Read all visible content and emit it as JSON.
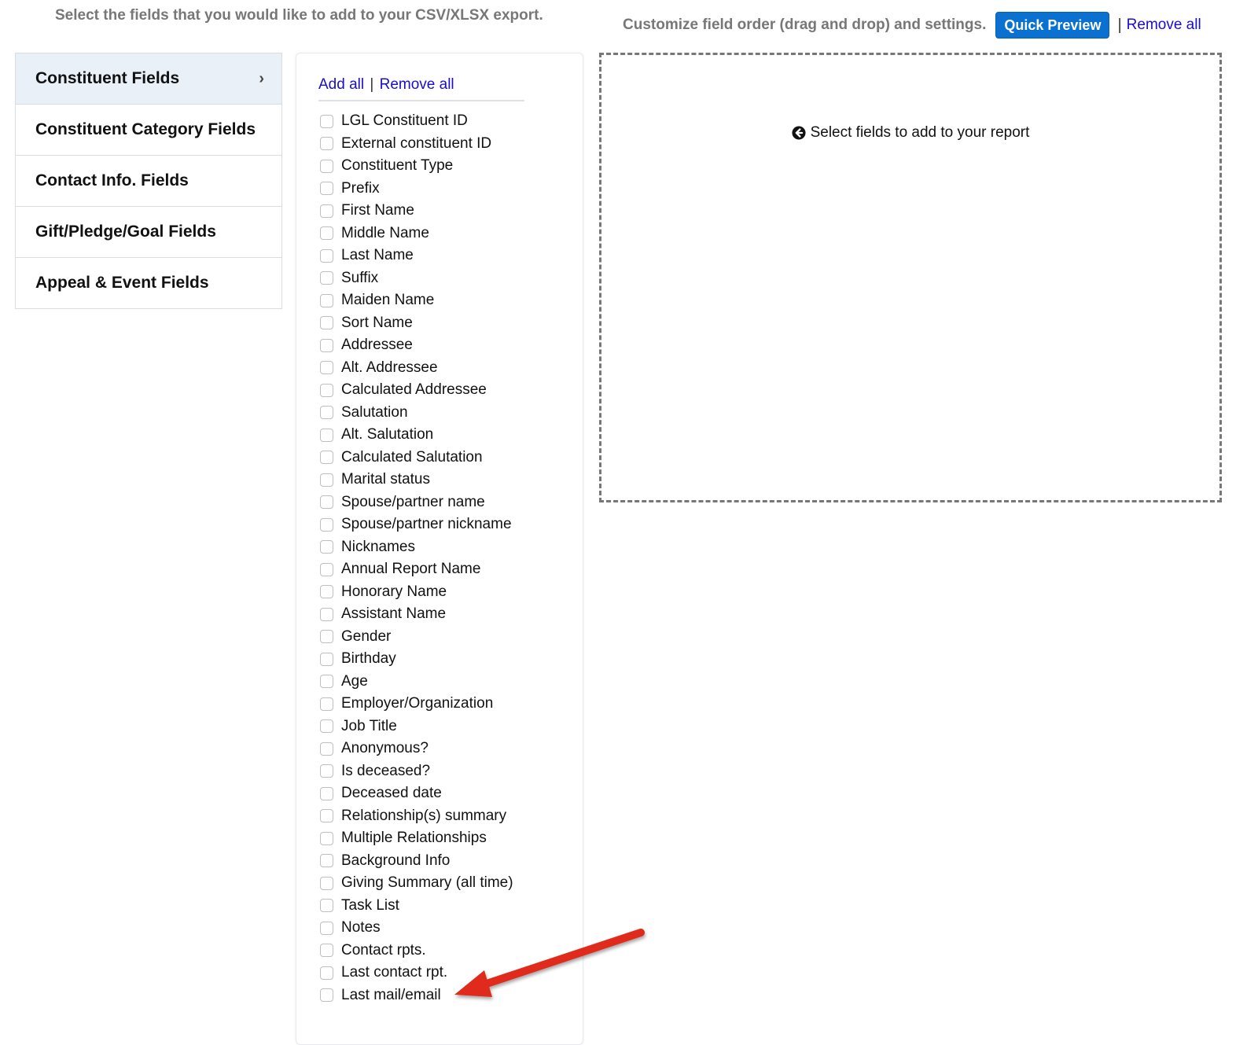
{
  "header": {
    "left_instruction": "Select the fields that you would like to add to your CSV/XLSX export.",
    "right_instruction": "Customize field order (drag and drop) and settings.",
    "quick_preview_label": "Quick Preview",
    "separator": "|",
    "remove_all_label": "Remove all"
  },
  "categories": [
    {
      "label": "Constituent Fields",
      "active": true,
      "icon": "chevron-right-icon",
      "chevron": "›"
    },
    {
      "label": "Constituent Category Fields"
    },
    {
      "label": "Contact Info. Fields"
    },
    {
      "label": "Gift/Pledge/Goal Fields"
    },
    {
      "label": "Appeal & Event Fields"
    }
  ],
  "fields_panel": {
    "add_all_label": "Add all",
    "separator": "|",
    "remove_all_label": "Remove all",
    "fields": [
      "LGL Constituent ID",
      "External constituent ID",
      "Constituent Type",
      "Prefix",
      "First Name",
      "Middle Name",
      "Last Name",
      "Suffix",
      "Maiden Name",
      "Sort Name",
      "Addressee",
      "Alt. Addressee",
      "Calculated Addressee",
      "Salutation",
      "Alt. Salutation",
      "Calculated Salutation",
      "Marital status",
      "Spouse/partner name",
      "Spouse/partner nickname",
      "Nicknames",
      "Annual Report Name",
      "Honorary Name",
      "Assistant Name",
      "Gender",
      "Birthday",
      "Age",
      "Employer/Organization",
      "Job Title",
      "Anonymous?",
      "Is deceased?",
      "Deceased date",
      "Relationship(s) summary",
      "Multiple Relationships",
      "Background Info",
      "Giving Summary (all time)",
      "Task List",
      "Notes",
      "Contact rpts.",
      "Last contact rpt.",
      "Last mail/email"
    ]
  },
  "dropzone": {
    "icon": "arrow-circle-left-icon",
    "message": "Select fields to add to your report"
  },
  "annotation": {
    "type": "red-arrow",
    "color": "#e0291b",
    "points_to": "Last mail/email"
  }
}
